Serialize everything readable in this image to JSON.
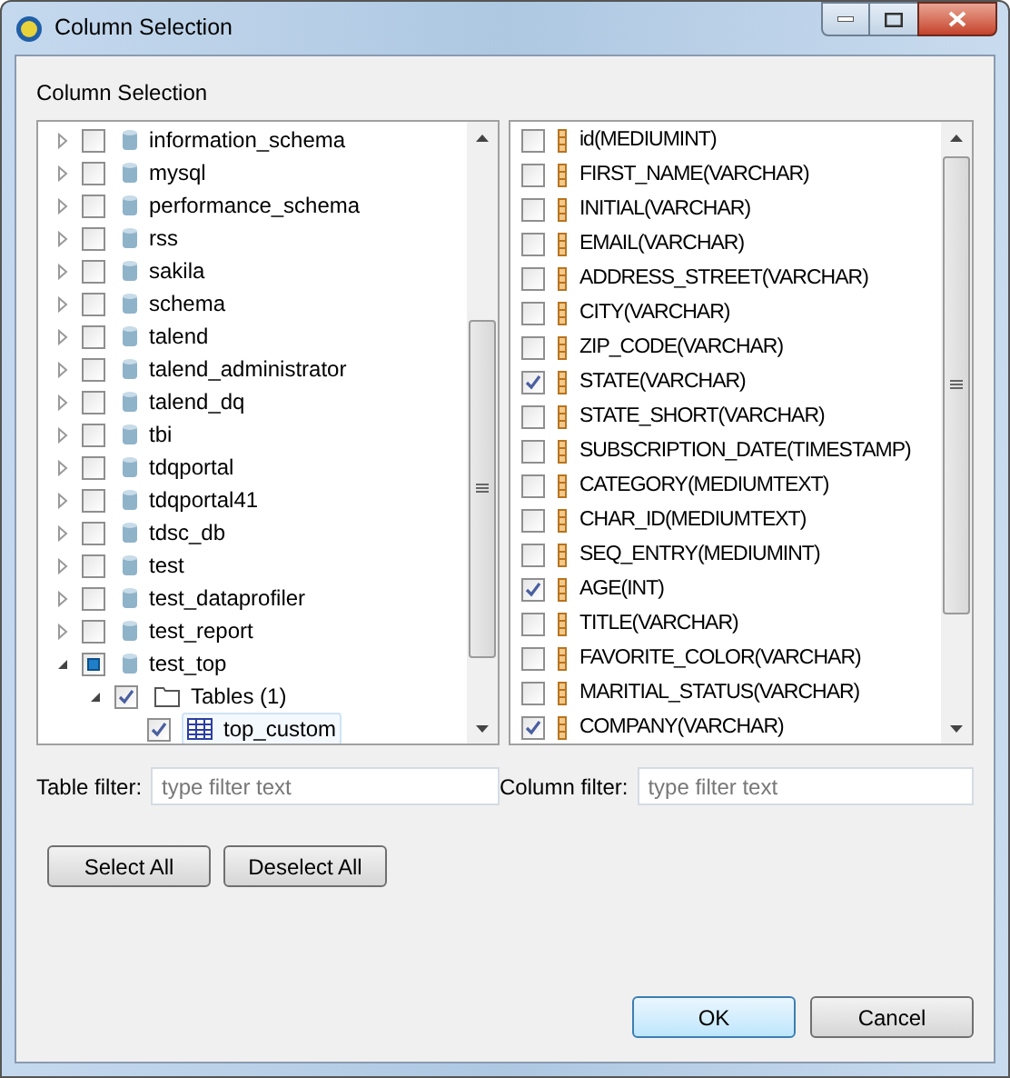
{
  "window": {
    "title": "Column Selection"
  },
  "section_label": "Column Selection",
  "tree": [
    {
      "label": "information_schema",
      "checked": false,
      "partial": false,
      "expanded": false,
      "selected": false
    },
    {
      "label": "mysql",
      "checked": false,
      "partial": false,
      "expanded": false,
      "selected": false
    },
    {
      "label": "performance_schema",
      "checked": false,
      "partial": false,
      "expanded": false,
      "selected": false
    },
    {
      "label": "rss",
      "checked": false,
      "partial": false,
      "expanded": false,
      "selected": false
    },
    {
      "label": "sakila",
      "checked": false,
      "partial": false,
      "expanded": false,
      "selected": false
    },
    {
      "label": "schema",
      "checked": false,
      "partial": false,
      "expanded": false,
      "selected": false
    },
    {
      "label": "talend",
      "checked": false,
      "partial": false,
      "expanded": false,
      "selected": false
    },
    {
      "label": "talend_administrator",
      "checked": false,
      "partial": false,
      "expanded": false,
      "selected": false
    },
    {
      "label": "talend_dq",
      "checked": false,
      "partial": false,
      "expanded": false,
      "selected": false
    },
    {
      "label": "tbi",
      "checked": false,
      "partial": false,
      "expanded": false,
      "selected": false
    },
    {
      "label": "tdqportal",
      "checked": false,
      "partial": false,
      "expanded": false,
      "selected": false
    },
    {
      "label": "tdqportal41",
      "checked": false,
      "partial": false,
      "expanded": false,
      "selected": false
    },
    {
      "label": "tdsc_db",
      "checked": false,
      "partial": false,
      "expanded": false,
      "selected": false
    },
    {
      "label": "test",
      "checked": false,
      "partial": false,
      "expanded": false,
      "selected": false
    },
    {
      "label": "test_dataprofiler",
      "checked": false,
      "partial": false,
      "expanded": false,
      "selected": false
    },
    {
      "label": "test_report",
      "checked": false,
      "partial": false,
      "expanded": false,
      "selected": false
    },
    {
      "label": "test_top",
      "checked": false,
      "partial": true,
      "expanded": true,
      "selected": false,
      "children": [
        {
          "label": "Tables (1)",
          "kind": "folder",
          "checked": true,
          "partial": false,
          "expanded": true,
          "selected": false,
          "children": [
            {
              "label": "top_custom",
              "kind": "table",
              "checked": true,
              "partial": false,
              "selected": true
            }
          ]
        }
      ]
    }
  ],
  "columns": [
    {
      "label": "id(MEDIUMINT)",
      "checked": false
    },
    {
      "label": "FIRST_NAME(VARCHAR)",
      "checked": false
    },
    {
      "label": "INITIAL(VARCHAR)",
      "checked": false
    },
    {
      "label": "EMAIL(VARCHAR)",
      "checked": false
    },
    {
      "label": "ADDRESS_STREET(VARCHAR)",
      "checked": false
    },
    {
      "label": "CITY(VARCHAR)",
      "checked": false
    },
    {
      "label": "ZIP_CODE(VARCHAR)",
      "checked": false
    },
    {
      "label": "STATE(VARCHAR)",
      "checked": true
    },
    {
      "label": "STATE_SHORT(VARCHAR)",
      "checked": false
    },
    {
      "label": "SUBSCRIPTION_DATE(TIMESTAMP)",
      "checked": false
    },
    {
      "label": "CATEGORY(MEDIUMTEXT)",
      "checked": false
    },
    {
      "label": "CHAR_ID(MEDIUMTEXT)",
      "checked": false
    },
    {
      "label": "SEQ_ENTRY(MEDIUMINT)",
      "checked": false
    },
    {
      "label": "AGE(INT)",
      "checked": true
    },
    {
      "label": "TITLE(VARCHAR)",
      "checked": false
    },
    {
      "label": "FAVORITE_COLOR(VARCHAR)",
      "checked": false
    },
    {
      "label": "MARITIAL_STATUS(VARCHAR)",
      "checked": false
    },
    {
      "label": "COMPANY(VARCHAR)",
      "checked": true
    }
  ],
  "filters": [
    {
      "label": "Table filter:",
      "placeholder": "type filter text"
    },
    {
      "label": "Column filter:",
      "placeholder": "type filter text"
    }
  ],
  "selection_buttons": [
    "Select All",
    "Deselect All"
  ],
  "dialog_buttons": [
    {
      "label": "OK",
      "default": true
    },
    {
      "label": "Cancel",
      "default": false
    }
  ]
}
